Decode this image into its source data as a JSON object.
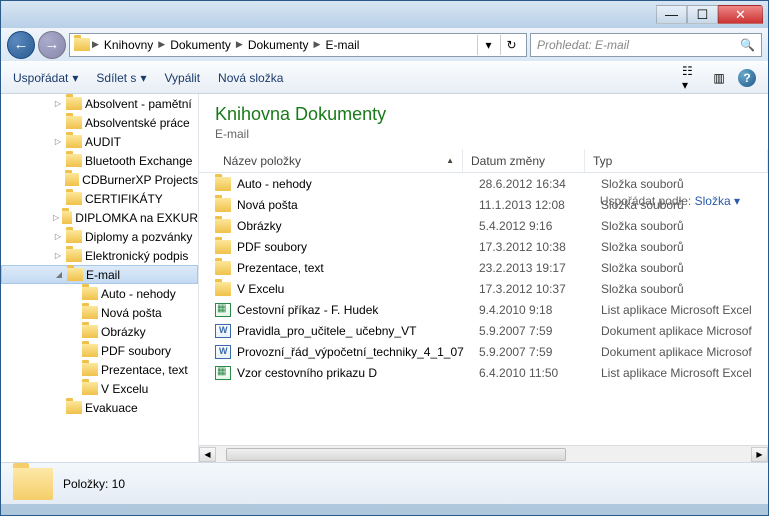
{
  "breadcrumbs": [
    "Knihovny",
    "Dokumenty",
    "Dokumenty",
    "E-mail"
  ],
  "search": {
    "placeholder": "Prohledat: E-mail"
  },
  "toolbar": {
    "organize": "Uspořádat",
    "share": "Sdílet s",
    "burn": "Vypálit",
    "newfolder": "Nová složka"
  },
  "tree": [
    {
      "d": 2,
      "e": "▷",
      "n": "Absolvent - pamětní"
    },
    {
      "d": 2,
      "e": "",
      "n": "Absolventské práce"
    },
    {
      "d": 2,
      "e": "▷",
      "n": "AUDIT"
    },
    {
      "d": 2,
      "e": "",
      "n": "Bluetooth Exchange"
    },
    {
      "d": 2,
      "e": "",
      "n": "CDBurnerXP Projects"
    },
    {
      "d": 2,
      "e": "",
      "n": "CERTIFIKÁTY"
    },
    {
      "d": 2,
      "e": "▷",
      "n": "DIPLOMKA na EXKUR"
    },
    {
      "d": 2,
      "e": "▷",
      "n": "Diplomy a pozvánky"
    },
    {
      "d": 2,
      "e": "▷",
      "n": "Elektronický podpis"
    },
    {
      "d": 2,
      "e": "◢",
      "n": "E-mail",
      "sel": true
    },
    {
      "d": 3,
      "e": "",
      "n": "Auto - nehody"
    },
    {
      "d": 3,
      "e": "",
      "n": "Nová pošta"
    },
    {
      "d": 3,
      "e": "",
      "n": "Obrázky"
    },
    {
      "d": 3,
      "e": "",
      "n": "PDF soubory"
    },
    {
      "d": 3,
      "e": "",
      "n": "Prezentace, text"
    },
    {
      "d": 3,
      "e": "",
      "n": "V Excelu"
    },
    {
      "d": 2,
      "e": "",
      "n": "Evakuace"
    }
  ],
  "header": {
    "title": "Knihovna Dokumenty",
    "sub": "E-mail",
    "arrlabel": "Uspořádat podle:",
    "arrval": "Složka"
  },
  "cols": {
    "name": "Název položky",
    "date": "Datum změny",
    "type": "Typ"
  },
  "items": [
    {
      "ic": "folder",
      "n": "Auto - nehody",
      "d": "28.6.2012 16:34",
      "t": "Složka souborů"
    },
    {
      "ic": "folder",
      "n": "Nová pošta",
      "d": "11.1.2013 12:08",
      "t": "Složka souborů"
    },
    {
      "ic": "folder",
      "n": "Obrázky",
      "d": "5.4.2012 9:16",
      "t": "Složka souborů"
    },
    {
      "ic": "folder",
      "n": "PDF soubory",
      "d": "17.3.2012 10:38",
      "t": "Složka souborů"
    },
    {
      "ic": "folder",
      "n": "Prezentace, text",
      "d": "23.2.2013 19:17",
      "t": "Složka souborů"
    },
    {
      "ic": "folder",
      "n": "V Excelu",
      "d": "17.3.2012 10:37",
      "t": "Složka souborů"
    },
    {
      "ic": "xls",
      "n": "Cestovní příkaz - F. Hudek",
      "d": "9.4.2010 9:18",
      "t": "List aplikace Microsoft Excel"
    },
    {
      "ic": "doc",
      "n": "Pravidla_pro_učitele_ učebny_VT",
      "d": "5.9.2007 7:59",
      "t": "Dokument aplikace Microsof"
    },
    {
      "ic": "doc",
      "n": "Provozní_řád_výpočetní_techniky_4_1_07",
      "d": "5.9.2007 7:59",
      "t": "Dokument aplikace Microsof"
    },
    {
      "ic": "xls",
      "n": "Vzor cestovního prikazu D",
      "d": "6.4.2010 11:50",
      "t": "List aplikace Microsoft Excel"
    }
  ],
  "status": {
    "count": "Položky: 10"
  }
}
